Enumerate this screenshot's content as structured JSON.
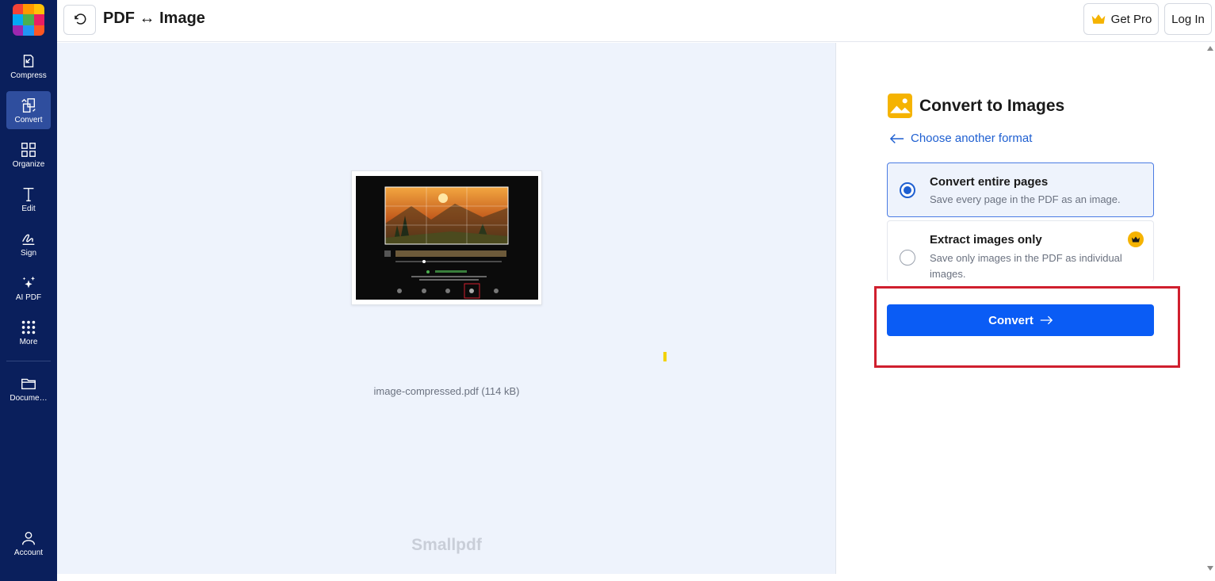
{
  "app": {
    "title": "PDF ↔ Image",
    "logo_colors": [
      "#f44336",
      "#ff9800",
      "#ffc107",
      "#03a9f4",
      "#4caf50",
      "#e91e63",
      "#9c27b0",
      "#2196f3",
      "#ff5722"
    ]
  },
  "sidebar": {
    "items": [
      {
        "label": "Compress",
        "icon": "compress-icon",
        "active": false
      },
      {
        "label": "Convert",
        "icon": "convert-icon",
        "active": true
      },
      {
        "label": "Organize",
        "icon": "organize-icon",
        "active": false
      },
      {
        "label": "Edit",
        "icon": "edit-text-icon",
        "active": false
      },
      {
        "label": "Sign",
        "icon": "signature-icon",
        "active": false
      },
      {
        "label": "AI PDF",
        "icon": "sparkle-icon",
        "active": false
      },
      {
        "label": "More",
        "icon": "grid-dots-icon",
        "active": false
      }
    ],
    "documents_label": "Docume…",
    "account_label": "Account"
  },
  "topbar": {
    "get_pro_label": "Get Pro",
    "login_label": "Log In"
  },
  "preview": {
    "file_name": "image-compressed.pdf (114 kB)",
    "watermark": "Smallpdf"
  },
  "panel": {
    "title": "Convert to Images",
    "choose_another": "Choose another format",
    "options": [
      {
        "title": "Convert entire pages",
        "description": "Save every page in the PDF as an image.",
        "selected": true,
        "pro": false
      },
      {
        "title": "Extract images only",
        "description": "Save only images in the PDF as individual images.",
        "selected": false,
        "pro": true
      }
    ],
    "convert_label": "Convert"
  },
  "colors": {
    "sidebar_bg": "#0a1f5c",
    "accent": "#0a5cf5",
    "link": "#1e5fd1",
    "highlight": "#d01f2e",
    "pro": "#f5b301"
  }
}
